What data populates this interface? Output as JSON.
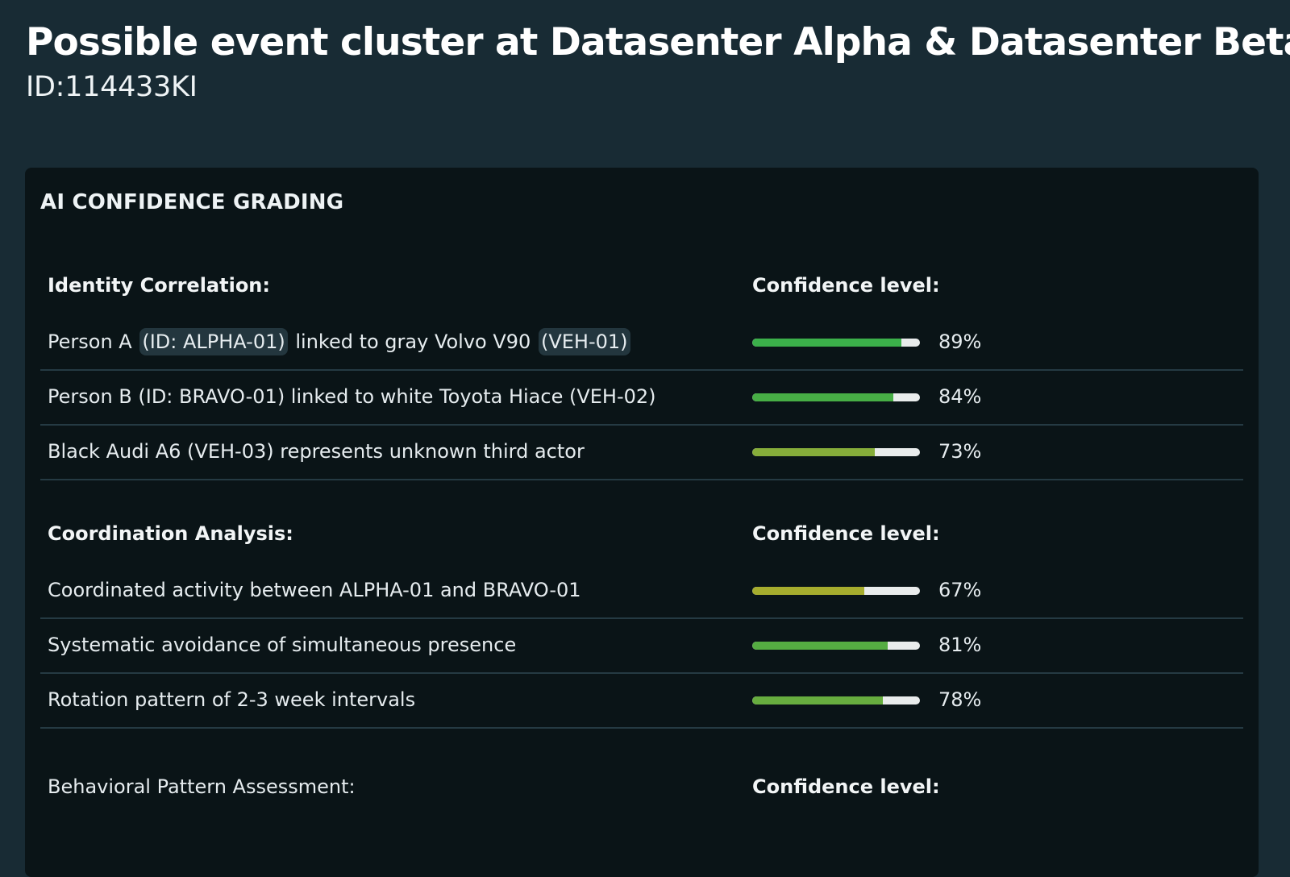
{
  "header": {
    "title": "Possible event cluster at Datasenter Alpha & Datasenter Beta",
    "subtitle": "ID:114433KI"
  },
  "panel": {
    "title": "AI CONFIDENCE GRADING",
    "sections": [
      {
        "title": "Identity Correlation:",
        "confidence_header": "Confidence level:",
        "rows": [
          {
            "parts": [
              {
                "text": "Person A ",
                "chip": false
              },
              {
                "text": "(ID: ALPHA-01)",
                "chip": true
              },
              {
                "text": " linked to gray Volvo V90 ",
                "chip": false
              },
              {
                "text": "(VEH-01)",
                "chip": true
              }
            ],
            "value": 89,
            "pct_label": "89%",
            "bar_color": "#3bb04a"
          },
          {
            "parts": [
              {
                "text": "Person B (ID: BRAVO-01) linked to white Toyota Hiace (VEH-02)",
                "chip": false
              }
            ],
            "value": 84,
            "pct_label": "84%",
            "bar_color": "#47ae45"
          },
          {
            "parts": [
              {
                "text": "Black Audi A6 (VEH-03) represents unknown third actor",
                "chip": false
              }
            ],
            "value": 73,
            "pct_label": "73%",
            "bar_color": "#86ad3a"
          }
        ]
      },
      {
        "title": "Coordination Analysis:",
        "confidence_header": "Confidence level:",
        "rows": [
          {
            "parts": [
              {
                "text": "Coordinated activity between ALPHA-01 and BRAVO-01",
                "chip": false
              }
            ],
            "value": 67,
            "pct_label": "67%",
            "bar_color": "#a6ad2e"
          },
          {
            "parts": [
              {
                "text": "Systematic avoidance of simultaneous presence",
                "chip": false
              }
            ],
            "value": 81,
            "pct_label": "81%",
            "bar_color": "#55ad42"
          },
          {
            "parts": [
              {
                "text": "Rotation pattern of 2-3 week intervals",
                "chip": false
              }
            ],
            "value": 78,
            "pct_label": "78%",
            "bar_color": "#67ad3f"
          }
        ]
      },
      {
        "title": "Behavioral Pattern Assessment:",
        "confidence_header": "Confidence level:",
        "rows": []
      }
    ]
  }
}
